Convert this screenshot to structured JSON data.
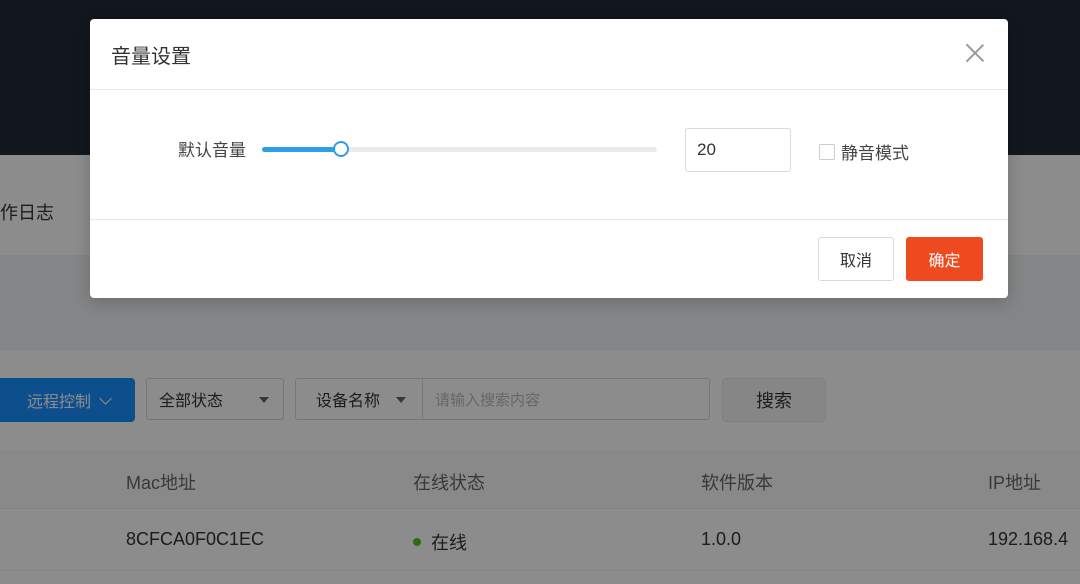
{
  "background": {
    "tab_label": "操作日志",
    "toolbar": {
      "remote_button": "远程控制",
      "status_select": "全部状态",
      "field_select": "设备名称",
      "search_placeholder": "请输入搜索内容",
      "search_button": "搜索"
    },
    "table": {
      "headers": [
        "Mac地址",
        "在线状态",
        "软件版本",
        "IP地址"
      ],
      "rows": [
        {
          "mac": "8CFCA0F0C1EC",
          "status": "在线",
          "version": "1.0.0",
          "ip": "192.168.4"
        }
      ],
      "status_color": "#52c41a"
    }
  },
  "modal": {
    "title": "音量设置",
    "volume_label": "默认音量",
    "volume_value": "20",
    "volume_level_percent": 20,
    "mute_label": "静音模式",
    "mute_checked": false,
    "cancel_label": "取消",
    "ok_label": "确定",
    "accent_color": "#2f9ee8",
    "primary_color": "#ef4a1f"
  }
}
